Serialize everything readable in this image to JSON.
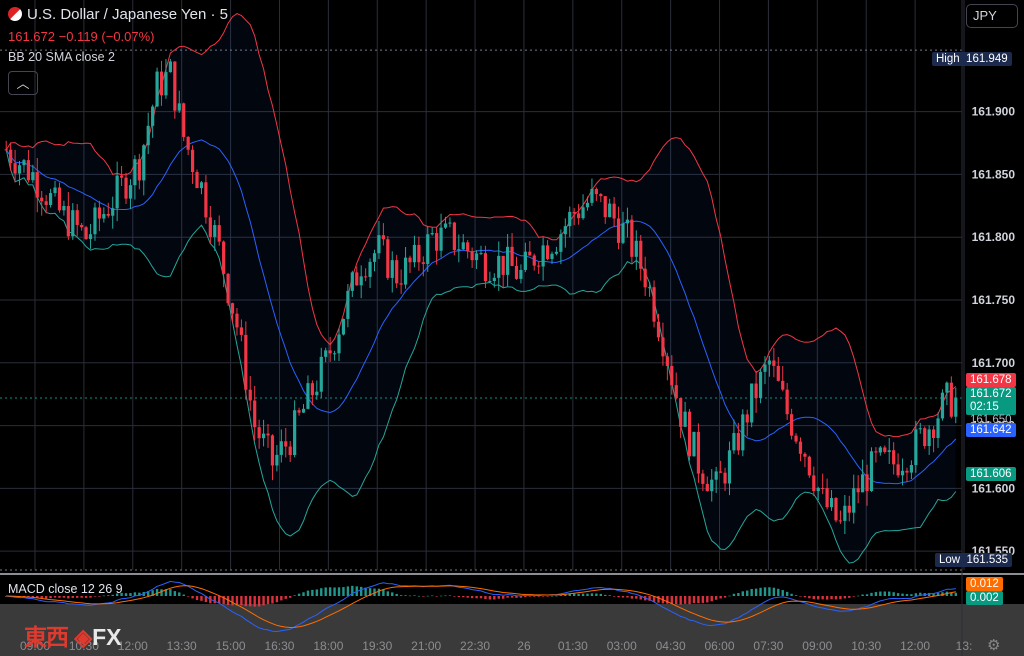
{
  "header": {
    "title": "U.S. Dollar / Japanese Yen · 5",
    "last": "161.672",
    "change": "−0.119 (−0.07%)",
    "indicator": "BB 20 SMA close 2",
    "collapse_icon": "chevron-up-icon",
    "currency": "JPY"
  },
  "colors": {
    "up": "#26a69a",
    "down": "#f23645",
    "bb_upper": "#f23645",
    "bb_basis": "#2962ff",
    "bb_lower": "#26a69a",
    "macd_line": "#2962ff",
    "signal_line": "#ff6d00"
  },
  "price_tags": {
    "high_label": "High",
    "high_value": "161.949",
    "low_label": "Low",
    "low_value": "161.535",
    "bb_upper": "161.678",
    "last_price": "161.672",
    "countdown": "02:15",
    "under_countdown": "161.650",
    "bb_basis": "161.642",
    "bb_lower": "161.606",
    "macd": "0.012",
    "signal": "0.002"
  },
  "macd": {
    "label": "MACD close 12 26 9"
  },
  "logo": {
    "cn": "東西",
    "fx": "FX"
  },
  "footer": {
    "settings_icon": "gear-icon"
  },
  "chart_data": {
    "type": "candlestick",
    "title": "U.S. Dollar / Japanese Yen · 5",
    "y_ticks": [
      "161.900",
      "161.850",
      "161.800",
      "161.750",
      "161.700",
      "161.650",
      "161.600",
      "161.550"
    ],
    "y_tick_values": [
      161.9,
      161.85,
      161.8,
      161.75,
      161.7,
      161.65,
      161.6,
      161.55
    ],
    "x_ticks": [
      "09:00",
      "10:30",
      "12:00",
      "13:30",
      "15:00",
      "16:30",
      "18:00",
      "19:30",
      "21:00",
      "22:30",
      "26",
      "01:30",
      "03:00",
      "04:30",
      "06:00",
      "07:30",
      "09:00",
      "10:30",
      "12:00",
      "13:"
    ],
    "ylim": [
      161.535,
      161.965
    ],
    "grid": true,
    "price_path": [
      [
        0,
        161.87
      ],
      [
        6,
        161.85
      ],
      [
        12,
        161.82
      ],
      [
        18,
        161.8
      ],
      [
        24,
        161.83
      ],
      [
        30,
        161.86
      ],
      [
        34,
        161.92
      ],
      [
        37,
        161.93
      ],
      [
        40,
        161.88
      ],
      [
        44,
        161.84
      ],
      [
        48,
        161.79
      ],
      [
        52,
        161.73
      ],
      [
        56,
        161.65
      ],
      [
        60,
        161.62
      ],
      [
        64,
        161.64
      ],
      [
        68,
        161.67
      ],
      [
        72,
        161.7
      ],
      [
        76,
        161.74
      ],
      [
        80,
        161.78
      ],
      [
        84,
        161.79
      ],
      [
        88,
        161.77
      ],
      [
        92,
        161.78
      ],
      [
        96,
        161.8
      ],
      [
        100,
        161.8
      ],
      [
        104,
        161.79
      ],
      [
        108,
        161.78
      ],
      [
        112,
        161.78
      ],
      [
        116,
        161.77
      ],
      [
        120,
        161.79
      ],
      [
        124,
        161.8
      ],
      [
        128,
        161.82
      ],
      [
        132,
        161.83
      ],
      [
        136,
        161.82
      ],
      [
        140,
        161.8
      ],
      [
        144,
        161.77
      ],
      [
        148,
        161.72
      ],
      [
        152,
        161.66
      ],
      [
        156,
        161.62
      ],
      [
        160,
        161.6
      ],
      [
        164,
        161.63
      ],
      [
        168,
        161.67
      ],
      [
        172,
        161.7
      ],
      [
        176,
        161.66
      ],
      [
        180,
        161.63
      ],
      [
        184,
        161.59
      ],
      [
        188,
        161.57
      ],
      [
        192,
        161.6
      ],
      [
        196,
        161.62
      ],
      [
        200,
        161.62
      ],
      [
        204,
        161.63
      ],
      [
        208,
        161.65
      ],
      [
        212,
        161.67
      ],
      [
        214,
        161.67
      ]
    ],
    "n_bars": 215,
    "bb_basis_last": 161.642,
    "bb_upper_last": 161.678,
    "bb_lower_last": 161.606,
    "macd_last": 0.012,
    "signal_last": 0.002
  }
}
